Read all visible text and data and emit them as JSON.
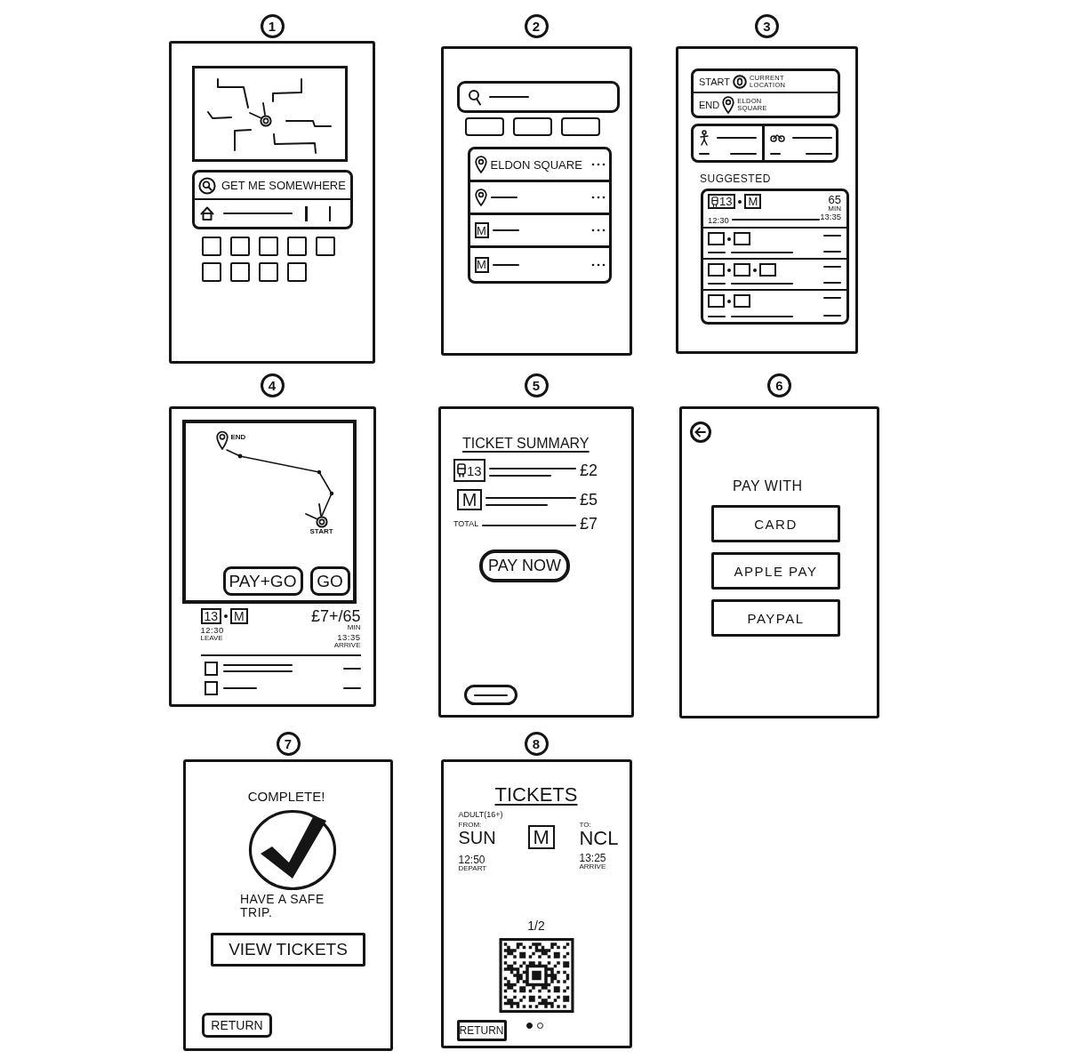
{
  "screens": [
    {
      "number": "1",
      "kind": "home",
      "search": {
        "placeholder": "GET ME SOMEWHERE"
      },
      "shortcuts": [
        {
          "kind": "tile"
        },
        {
          "kind": "tile"
        },
        {
          "kind": "tile"
        },
        {
          "kind": "tile"
        },
        {
          "kind": "tile"
        },
        {
          "kind": "tile"
        },
        {
          "kind": "tile"
        },
        {
          "kind": "tile"
        },
        {
          "kind": "tile"
        }
      ]
    },
    {
      "number": "2",
      "kind": "search",
      "filters": [
        {
          "kind": "chip"
        },
        {
          "kind": "chip"
        },
        {
          "kind": "chip"
        }
      ],
      "results": [
        {
          "kind": "place",
          "name": "ELDON SQUARE"
        },
        {
          "kind": "place"
        },
        {
          "kind": "metro",
          "logo": "M"
        },
        {
          "kind": "metro",
          "logo": "M"
        }
      ]
    },
    {
      "number": "3",
      "kind": "routes",
      "journey": [
        {
          "kind": "start",
          "label": "START",
          "place": "CURRENT LOCATION"
        },
        {
          "kind": "end",
          "label": "END",
          "place": "ELDON SQUARE"
        }
      ],
      "modes": [
        {
          "kind": "walk"
        },
        {
          "kind": "cycle"
        }
      ],
      "heading": "SUGGESTED",
      "routes": [
        {
          "legs": [
            {
              "kind": "bus",
              "route": "13"
            },
            {
              "kind": "metro",
              "logo": "M"
            }
          ],
          "duration": "65",
          "duration_unit": "MIN",
          "depart": "12:30",
          "arrive": "13:35"
        },
        {
          "legs": [
            {
              "kind": "blank"
            },
            {
              "kind": "blank"
            }
          ]
        },
        {
          "legs": [
            {
              "kind": "blank"
            },
            {
              "kind": "blank"
            },
            {
              "kind": "blank"
            }
          ]
        },
        {
          "legs": [
            {
              "kind": "blank"
            },
            {
              "kind": "blank"
            }
          ]
        }
      ]
    },
    {
      "number": "4",
      "kind": "route_map",
      "map": {
        "end_label": "END",
        "start_label": "START"
      },
      "buttons": [
        {
          "kind": "pay_go",
          "label": "PAY+GO"
        },
        {
          "kind": "go",
          "label": "GO"
        }
      ],
      "legs": [
        {
          "kind": "number",
          "route": "13"
        },
        {
          "kind": "metro",
          "logo": "M"
        }
      ],
      "leave": "12:30",
      "leave_label": "LEAVE",
      "fare": "£7+/65",
      "fare_unit": "MIN",
      "arrive": "13:35",
      "arrive_label": "ARRIVE",
      "steps": [
        {
          "kind": "two_line"
        },
        {
          "kind": "one_line"
        }
      ]
    },
    {
      "number": "5",
      "kind": "summary",
      "title": "TICKET SUMMARY",
      "items": [
        {
          "kind": "bus",
          "route": "13",
          "price": "£2"
        },
        {
          "kind": "metro",
          "logo": "M",
          "price": "£5"
        },
        {
          "kind": "total",
          "label": "TOTAL",
          "price": "£7"
        }
      ],
      "button": "PAY NOW"
    },
    {
      "number": "6",
      "kind": "payment",
      "heading": "PAY WITH",
      "options": [
        "CARD",
        "APPLE PAY",
        "PAYPAL"
      ]
    },
    {
      "number": "7",
      "kind": "complete",
      "heading": "COMPLETE!",
      "message": "HAVE A SAFE TRIP.",
      "button": "VIEW TICKETS",
      "return_button": "RETURN"
    },
    {
      "number": "8",
      "kind": "tickets",
      "title": "TICKETS",
      "fare_type": "ADULT(16+)",
      "from": {
        "label": "FROM:",
        "code": "SUN",
        "time": "12:50",
        "time_label": "DEPART"
      },
      "logo": "M",
      "to": {
        "label": "TO:",
        "code": "NCL",
        "time": "13:25",
        "time_label": "ARRIVE"
      },
      "counter": "1/2",
      "return_button": "RETURN",
      "pages": [
        {
          "selected": true
        },
        {
          "selected": false
        }
      ]
    }
  ]
}
